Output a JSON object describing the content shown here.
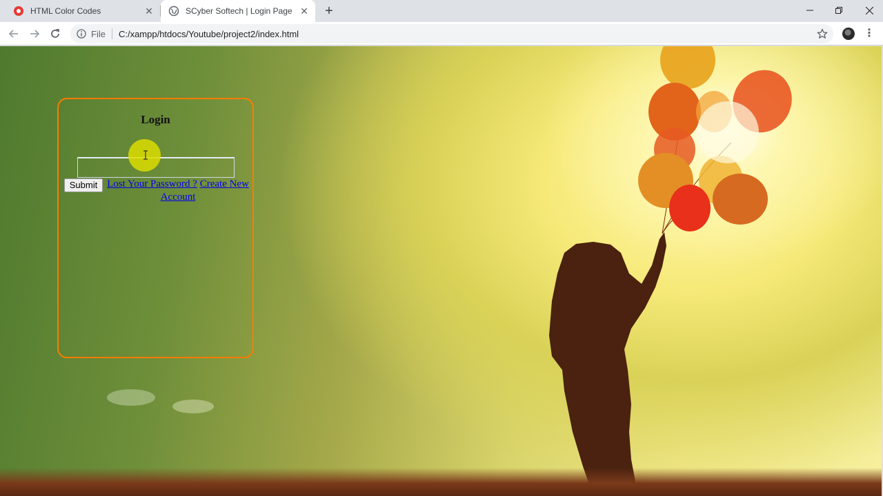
{
  "browser": {
    "tabs": [
      {
        "title": "HTML Color Codes",
        "favicon": "html-color-codes-favicon",
        "active": false
      },
      {
        "title": "SCyber Softech | Login Page",
        "favicon": "globe-icon",
        "active": true
      }
    ],
    "omnibox": {
      "scheme_label": "File",
      "url": "C:/xampp/htdocs/Youtube/project2/index.html"
    }
  },
  "page": {
    "login": {
      "title": "Login",
      "input_value": "",
      "submit_label": "Submit",
      "lost_password_link": "Lost Your Password ?",
      "create_account_link": "Create New Account"
    }
  },
  "colors": {
    "login_border": "#ff7a00",
    "link": "#0000ee",
    "cursor_highlight": "#dcdc00"
  }
}
